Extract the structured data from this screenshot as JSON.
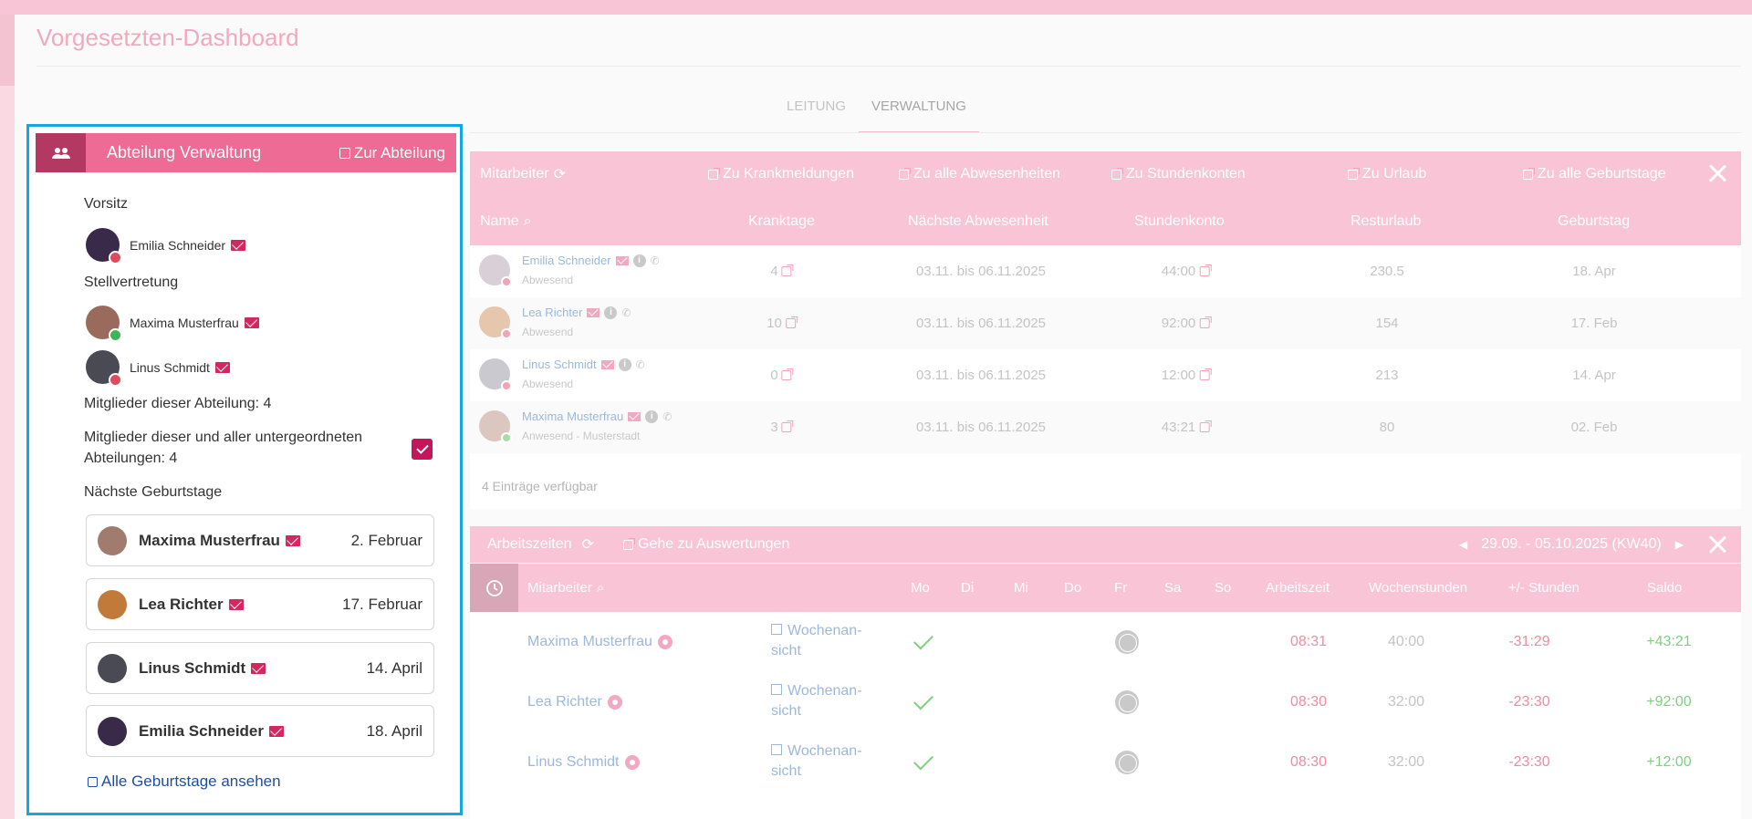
{
  "page": {
    "title": "Vorgesetzten-Dashboard"
  },
  "tabs": [
    {
      "label": "LEITUNG"
    },
    {
      "label": "VERWALTUNG"
    }
  ],
  "colors": {
    "accent": "#ee6b95",
    "accent_dark": "#b33862",
    "header_pink": "#f9c5d6",
    "selection_border": "#12a7e0",
    "check": "#c2185b"
  },
  "department": {
    "title": "Abteilung Verwaltung",
    "link_label": "Zur Abteilung",
    "chair_label": "Vorsitz",
    "chair": [
      {
        "name": "Emilia Schneider",
        "status": "red"
      }
    ],
    "deputy_label": "Stellvertretung",
    "deputies": [
      {
        "name": "Maxima Musterfrau",
        "status": "green"
      },
      {
        "name": "Linus Schmidt",
        "status": "red"
      }
    ],
    "members_label": "Mitglieder dieser Abteilung: 4",
    "all_members_label_1": "Mitglieder dieser und aller untergeordneten",
    "all_members_label_2": "Abteilungen: 4",
    "all_members_checked": true,
    "birthdays_label": "Nächste Geburtstage",
    "birthdays": [
      {
        "name": "Maxima Musterfrau",
        "date": "2. Februar"
      },
      {
        "name": "Lea Richter",
        "date": "17. Februar"
      },
      {
        "name": "Linus Schmidt",
        "date": "14. April"
      },
      {
        "name": "Emilia Schneider",
        "date": "18. April"
      }
    ],
    "all_birthdays_link": "Alle Geburtstage ansehen"
  },
  "employees": {
    "title": "Mitarbeiter",
    "links": [
      "Zu Krankmeldungen",
      "Zu alle Abwesenheiten",
      "Zu Stundenkonten",
      "Zu Urlaub",
      "Zu alle Geburtstage"
    ],
    "columns": [
      "Name",
      "Kranktage",
      "Nächste Abwesenheit",
      "Stundenkonto",
      "Resturlaub",
      "Geburtstag"
    ],
    "rows": [
      {
        "name": "Emilia Schneider",
        "status": "Abwesend",
        "dot": "red",
        "sick": "4",
        "absence": "03.11. bis 06.11.2025",
        "hours": "44:00",
        "vacation": "230.5",
        "birthday": "18. Apr"
      },
      {
        "name": "Lea Richter",
        "status": "Abwesend",
        "dot": "red",
        "sick": "10",
        "absence": "03.11. bis 06.11.2025",
        "hours": "92:00",
        "vacation": "154",
        "birthday": "17. Feb"
      },
      {
        "name": "Linus Schmidt",
        "status": "Abwesend",
        "dot": "red",
        "sick": "0",
        "absence": "03.11. bis 06.11.2025",
        "hours": "12:00",
        "vacation": "213",
        "birthday": "14. Apr"
      },
      {
        "name": "Maxima Musterfrau",
        "status": "Anwesend - Musterstadt",
        "dot": "green",
        "sick": "3",
        "absence": "03.11. bis 06.11.2025",
        "hours": "43:21",
        "vacation": "80",
        "birthday": "02. Feb"
      }
    ],
    "footer": "4 Einträge verfügbar"
  },
  "worktimes": {
    "title": "Arbeitszeiten",
    "evaluation_link": "Gehe zu Auswertungen",
    "week_range": "29.09. - 05.10.2025 (KW40)",
    "columns": [
      "Mitarbeiter",
      "Mo",
      "Di",
      "Mi",
      "Do",
      "Fr",
      "Sa",
      "So",
      "Arbeitszeit",
      "Wochenstunden",
      "+/- Stunden",
      "Saldo"
    ],
    "week_view_1": "Wochenan-",
    "week_view_2": "sicht",
    "rows": [
      {
        "name": "Maxima Musterfrau",
        "worktime": "08:31",
        "weekly": "40:00",
        "diff": "-31:29",
        "balance": "+43:21"
      },
      {
        "name": "Lea Richter",
        "worktime": "08:30",
        "weekly": "32:00",
        "diff": "-23:30",
        "balance": "+92:00"
      },
      {
        "name": "Linus Schmidt",
        "worktime": "08:30",
        "weekly": "32:00",
        "diff": "-23:30",
        "balance": "+12:00"
      }
    ]
  }
}
